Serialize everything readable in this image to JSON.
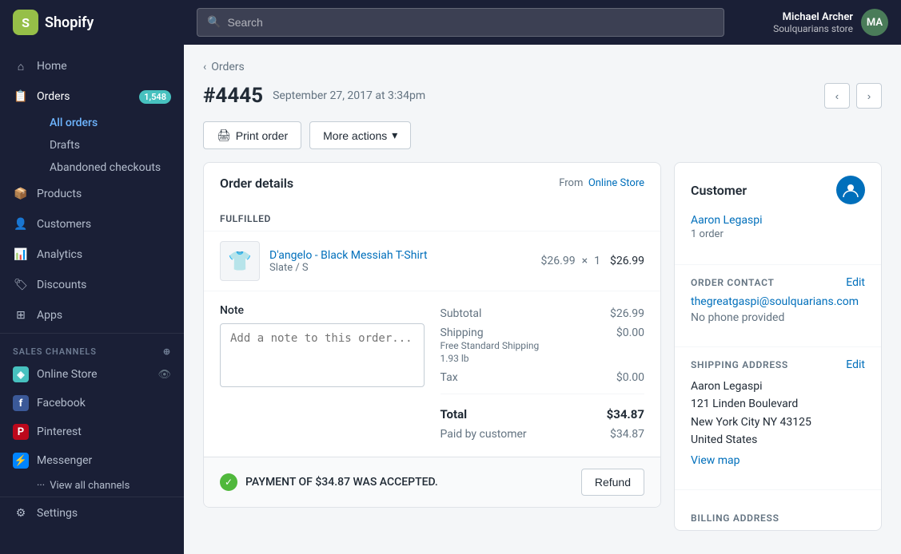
{
  "topnav": {
    "logo_text": "shopify",
    "logo_initials": "S",
    "search_placeholder": "Search",
    "user_initials": "MA",
    "user_name": "Michael Archer",
    "user_store": "Soulquarians store"
  },
  "sidebar": {
    "items": [
      {
        "id": "home",
        "label": "Home",
        "icon": "home"
      },
      {
        "id": "orders",
        "label": "Orders",
        "icon": "orders",
        "badge": "1,548"
      },
      {
        "id": "all-orders",
        "label": "All orders",
        "sub": true,
        "active": true
      },
      {
        "id": "drafts",
        "label": "Drafts",
        "sub": true
      },
      {
        "id": "abandoned",
        "label": "Abandoned checkouts",
        "sub": true
      },
      {
        "id": "products",
        "label": "Products",
        "icon": "products"
      },
      {
        "id": "customers",
        "label": "Customers",
        "icon": "customers"
      },
      {
        "id": "analytics",
        "label": "Analytics",
        "icon": "analytics"
      },
      {
        "id": "discounts",
        "label": "Discounts",
        "icon": "discounts"
      },
      {
        "id": "apps",
        "label": "Apps",
        "icon": "apps"
      }
    ],
    "sales_channels_label": "SALES CHANNELS",
    "channels": [
      {
        "id": "online-store",
        "label": "Online Store",
        "type": "store"
      },
      {
        "id": "facebook",
        "label": "Facebook",
        "type": "fb"
      },
      {
        "id": "pinterest",
        "label": "Pinterest",
        "type": "pin"
      },
      {
        "id": "messenger",
        "label": "Messenger",
        "type": "msg"
      }
    ],
    "view_all_label": "View all channels",
    "settings_label": "Settings"
  },
  "breadcrumb": {
    "link_label": "Orders"
  },
  "order": {
    "number": "#4445",
    "date": "September 27, 2017 at 3:34pm",
    "order_details_title": "Order details",
    "from_label": "From",
    "from_source": "Online Store",
    "fulfilled_label": "FULFILLED",
    "product_name": "D'angelo - Black Messiah T-Shirt",
    "product_variant": "Slate / S",
    "product_price": "$26.99",
    "product_x": "×",
    "product_qty": "1",
    "product_total": "$26.99",
    "note_label": "Note",
    "note_placeholder": "Add a note to this order...",
    "subtotal_label": "Subtotal",
    "subtotal_value": "$26.99",
    "shipping_label": "Shipping",
    "shipping_sub": "Free Standard Shipping",
    "shipping_weight": "1.93 lb",
    "shipping_value": "$0.00",
    "tax_label": "Tax",
    "tax_value": "$0.00",
    "total_label": "Total",
    "total_value": "$34.87",
    "paid_label": "Paid by customer",
    "paid_value": "$34.87",
    "payment_banner": "PAYMENT OF $34.87 WAS ACCEPTED.",
    "refund_label": "Refund"
  },
  "toolbar": {
    "print_label": "Print order",
    "more_actions_label": "More actions"
  },
  "customer": {
    "section_title": "Customer",
    "name": "Aaron Legaspi",
    "orders": "1 order",
    "contact_label": "ORDER CONTACT",
    "edit_label": "Edit",
    "email": "thegreatgaspi@soulquarians.com",
    "phone": "No phone provided",
    "shipping_label": "SHIPPING ADDRESS",
    "shipping_edit": "Edit",
    "address_name": "Aaron Legaspi",
    "address_line1": "121 Linden Boulevard",
    "address_city": "New York City NY 43125",
    "address_country": "United States",
    "view_map": "View map",
    "billing_label": "BILLING ADDRESS"
  },
  "nav_arrows": {
    "prev": "‹",
    "next": "›"
  }
}
